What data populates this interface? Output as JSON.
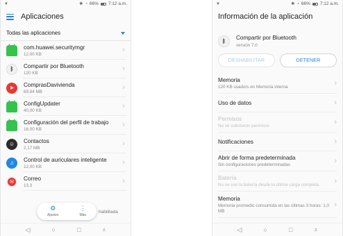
{
  "colors": {
    "accent": "#2a7fd6",
    "background": "#fafafa"
  },
  "status_bar": {
    "battery": "66%",
    "time": "7:12 a.m."
  },
  "left_screen": {
    "title": "Aplicaciones",
    "filter_label": "Todas las aplicaciones",
    "apps": [
      {
        "name": "com.huawei.securitymgr",
        "size": "12,00 KB",
        "icon": "android-icon"
      },
      {
        "name": "Compartir por Bluetooth",
        "size": "120 KB",
        "icon": "bluetooth-icon"
      },
      {
        "name": "ComprasDavivienda",
        "size": "69,84 MB",
        "icon": "davivienda-icon"
      },
      {
        "name": "ConfigUpdater",
        "size": "40,00 KB",
        "icon": "android-icon"
      },
      {
        "name": "Configuración del perfil de trabajo",
        "size": "16,00 KB",
        "icon": "android-icon"
      },
      {
        "name": "Contactos",
        "size": "2,17 MB",
        "icon": "contacts-icon"
      },
      {
        "name": "Control de auriculares inteligente",
        "size": "12,00 KB",
        "icon": "headset-icon"
      },
      {
        "name": "Correo",
        "size": "13,3",
        "icon": "mail-icon"
      }
    ],
    "floating_bar": {
      "settings_label": "Ajustes",
      "more_label": "Más",
      "peek_text": "habilitada"
    }
  },
  "right_screen": {
    "title": "Información de la aplicación",
    "app_name": "Compartir por Bluetooth",
    "version": "versión 7.0",
    "disable_button": "DESHABILITAR",
    "stop_button": "DETENER",
    "rows": [
      {
        "title": "Memoria",
        "subtitle": "120 KB usado/s en Memoria interna",
        "disabled": false
      },
      {
        "title": "Uso de datos",
        "subtitle": "",
        "disabled": false
      },
      {
        "title": "Permisos",
        "subtitle": "No se solicitaron permisos",
        "disabled": true
      },
      {
        "title": "Notificaciones",
        "subtitle": "",
        "disabled": false
      },
      {
        "title": "Abrir de forma predeterminada",
        "subtitle": "Sin configuraciones predeterminadas",
        "disabled": false
      },
      {
        "title": "Batería",
        "subtitle": "No se usó la batería desde la última carga completa.",
        "disabled": true
      },
      {
        "title": "Memoria",
        "subtitle": "Memoria promedio consumida en las últimas 3 horas: 1,0 MB",
        "disabled": false
      }
    ]
  }
}
